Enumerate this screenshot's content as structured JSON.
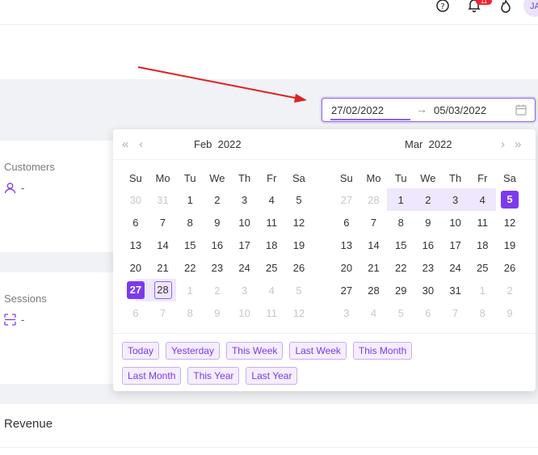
{
  "topbar": {
    "help_icon": "help-circle-icon",
    "bell_icon": "bell-icon",
    "notification_count": "11",
    "fire_icon": "fire-icon",
    "avatar_initials": "JA"
  },
  "date_range": {
    "start": "27/02/2022",
    "arrow": "→",
    "end": "05/03/2022",
    "icon": "calendar-icon"
  },
  "cards": {
    "customers": {
      "title": "Customers",
      "value": "-",
      "icon": "user-icon"
    },
    "sessions": {
      "title": "Sessions",
      "value": "-",
      "icon": "scan-icon"
    },
    "revenue": {
      "title": "Revenue"
    }
  },
  "calendar": {
    "nav": {
      "super_prev": "«",
      "prev": "‹",
      "next": "›",
      "super_next": "»"
    },
    "weekdays": [
      "Su",
      "Mo",
      "Tu",
      "We",
      "Th",
      "Fr",
      "Sa"
    ],
    "left": {
      "month": "Feb",
      "year": "2022",
      "weeks": [
        [
          "30",
          "31",
          "1",
          "2",
          "3",
          "4",
          "5"
        ],
        [
          "6",
          "7",
          "8",
          "9",
          "10",
          "11",
          "12"
        ],
        [
          "13",
          "14",
          "15",
          "16",
          "17",
          "18",
          "19"
        ],
        [
          "20",
          "21",
          "22",
          "23",
          "24",
          "25",
          "26"
        ],
        [
          "27",
          "28",
          "1",
          "2",
          "3",
          "4",
          "5"
        ],
        [
          "6",
          "7",
          "8",
          "9",
          "10",
          "11",
          "12"
        ]
      ]
    },
    "right": {
      "month": "Mar",
      "year": "2022",
      "weeks": [
        [
          "27",
          "28",
          "1",
          "2",
          "3",
          "4",
          "5"
        ],
        [
          "6",
          "7",
          "8",
          "9",
          "10",
          "11",
          "12"
        ],
        [
          "13",
          "14",
          "15",
          "16",
          "17",
          "18",
          "19"
        ],
        [
          "20",
          "21",
          "22",
          "23",
          "24",
          "25",
          "26"
        ],
        [
          "27",
          "28",
          "29",
          "30",
          "31",
          "1",
          "2"
        ],
        [
          "3",
          "4",
          "5",
          "6",
          "7",
          "8",
          "9"
        ]
      ]
    },
    "presets": [
      "Today",
      "Yesterday",
      "This Week",
      "Last Week",
      "This Month",
      "Last Month",
      "This Year",
      "Last Year"
    ]
  },
  "colors": {
    "accent": "#7c3aed",
    "range_bg": "#efe7fd",
    "annotation_arrow": "#e02020"
  }
}
